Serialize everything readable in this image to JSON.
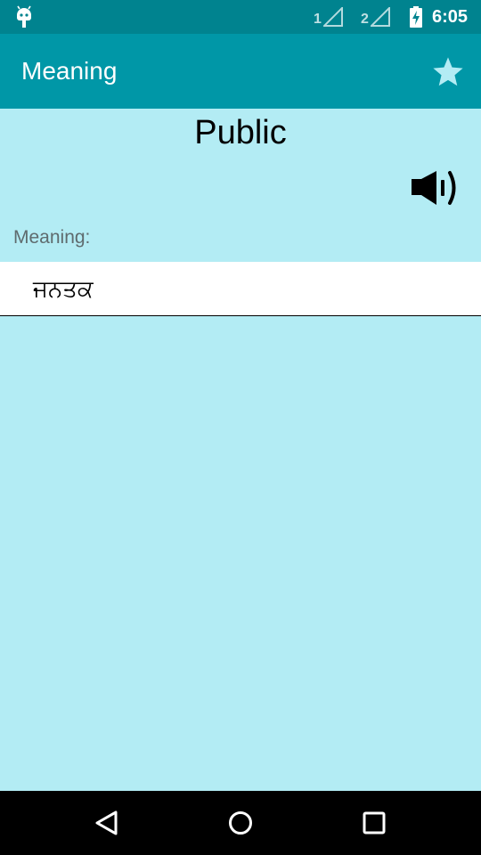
{
  "status_bar": {
    "sim1_label": "1",
    "sim2_label": "2",
    "time": "6:05",
    "left_icon": "android-debug-icon",
    "battery_icon": "battery-charging-icon"
  },
  "app_bar": {
    "title": "Meaning",
    "favorite_icon": "star-icon"
  },
  "content": {
    "word": "Public",
    "speaker_icon": "speaker-icon",
    "meaning_label": "Meaning:",
    "meaning_text": "ਜਨਤਕ"
  },
  "nav_bar": {
    "back_icon": "back-triangle-icon",
    "home_icon": "home-circle-icon",
    "recents_icon": "recents-square-icon"
  },
  "colors": {
    "status_bar": "#00838f",
    "app_bar": "#0097a7",
    "background": "#b3ecf4",
    "star": "#b3ecf4",
    "meaning_box": "#ffffff",
    "nav_bar": "#000000"
  }
}
